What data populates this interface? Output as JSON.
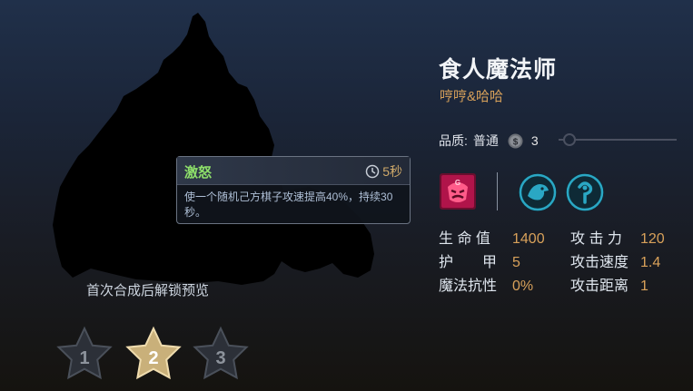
{
  "preview": {
    "unlock_text": "首次合成后解锁预览"
  },
  "skill": {
    "name": "激怒",
    "cooldown": "5秒",
    "description": "使一个随机己方棋子攻速提高40%，持续30秒。",
    "icon": "clock-icon"
  },
  "champion": {
    "name": "食人魔法师",
    "nickname": "哼哼&哈哈",
    "quality_label": "品质:",
    "quality_value": "普通",
    "cost": "3",
    "cost_icon": "coin-icon"
  },
  "traits": {
    "origin_icon": "ogre-trait-icon",
    "class_icons": [
      "dragon-trait-icon",
      "mage-trait-icon"
    ]
  },
  "stats": [
    {
      "label": "生 命 值",
      "value": "1400"
    },
    {
      "label": "攻 击 力",
      "value": "120"
    },
    {
      "label": "护　　甲",
      "value": "5"
    },
    {
      "label": "攻击速度",
      "value": "1.4"
    },
    {
      "label": "魔法抗性",
      "value": "0%"
    },
    {
      "label": "攻击距离",
      "value": "1"
    }
  ],
  "star_levels": {
    "levels": [
      "1",
      "2",
      "3"
    ],
    "selected": "2"
  },
  "colors": {
    "gold_accent": "#d8a15a",
    "skill_green": "#8ee06a",
    "star_selected": "#c9b07a",
    "star_unselected": "#3a3f48"
  }
}
